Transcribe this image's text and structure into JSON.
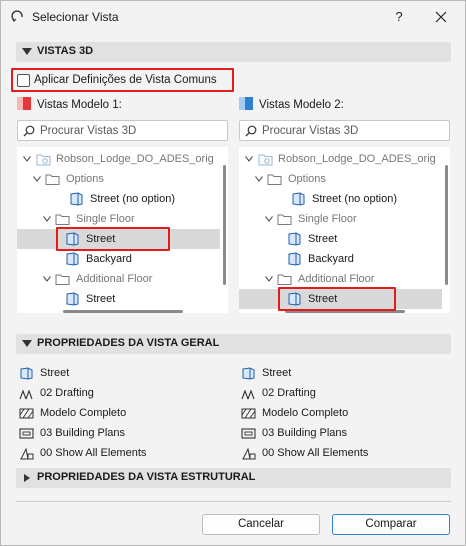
{
  "window": {
    "title": "Selecionar Vista",
    "help_label": "?"
  },
  "sections": {
    "views_3d": "VISTAS 3D",
    "general": "PROPRIEDADES DA VISTA GERAL",
    "structural": "PROPRIEDADES DA VISTA ESTRUTURAL"
  },
  "apply_common": {
    "label": "Aplicar Definições de Vista Comuns",
    "checked": false
  },
  "model1": {
    "title": "Vistas Modelo 1:",
    "color": "#e8363a",
    "search_placeholder": "Procurar Vistas 3D",
    "tree": [
      {
        "label": "Robson_Lodge_DO_ADES_orig",
        "type": "root",
        "muted": true
      },
      {
        "label": "Options",
        "type": "folder",
        "muted": true
      },
      {
        "label": "Street (no option)",
        "type": "view",
        "muted": false
      },
      {
        "label": "Single Floor",
        "type": "folder",
        "muted": true
      },
      {
        "label": "Street",
        "type": "view",
        "muted": false,
        "selected": true
      },
      {
        "label": "Backyard",
        "type": "view",
        "muted": false
      },
      {
        "label": "Additional Floor",
        "type": "folder",
        "muted": true
      },
      {
        "label": "Street",
        "type": "view",
        "muted": false
      }
    ]
  },
  "model2": {
    "title": "Vistas Modelo 2:",
    "color": "#2f7fd1",
    "search_placeholder": "Procurar Vistas 3D",
    "tree": [
      {
        "label": "Robson_Lodge_DO_ADES_orig",
        "type": "root",
        "muted": true
      },
      {
        "label": "Options",
        "type": "folder",
        "muted": true
      },
      {
        "label": "Street (no option)",
        "type": "view",
        "muted": false
      },
      {
        "label": "Single Floor",
        "type": "folder",
        "muted": true
      },
      {
        "label": "Street",
        "type": "view",
        "muted": false
      },
      {
        "label": "Backyard",
        "type": "view",
        "muted": false
      },
      {
        "label": "Additional Floor",
        "type": "folder",
        "muted": true
      },
      {
        "label": "Street",
        "type": "view",
        "muted": false,
        "selected": true
      }
    ]
  },
  "general_props": {
    "left": [
      {
        "icon": "view-icon",
        "value": "Street"
      },
      {
        "icon": "drafting-icon",
        "value": "02 Drafting"
      },
      {
        "icon": "model-hatch-icon",
        "value": "Modelo Completo"
      },
      {
        "icon": "plan-icon",
        "value": "03 Building Plans"
      },
      {
        "icon": "elements-icon",
        "value": "00 Show All Elements"
      }
    ],
    "right": [
      {
        "icon": "view-icon",
        "value": "Street"
      },
      {
        "icon": "drafting-icon",
        "value": "02 Drafting"
      },
      {
        "icon": "model-hatch-icon",
        "value": "Modelo Completo"
      },
      {
        "icon": "plan-icon",
        "value": "03 Building Plans"
      },
      {
        "icon": "elements-icon",
        "value": "00 Show All Elements"
      }
    ]
  },
  "buttons": {
    "cancel": "Cancelar",
    "compare": "Comparar"
  }
}
